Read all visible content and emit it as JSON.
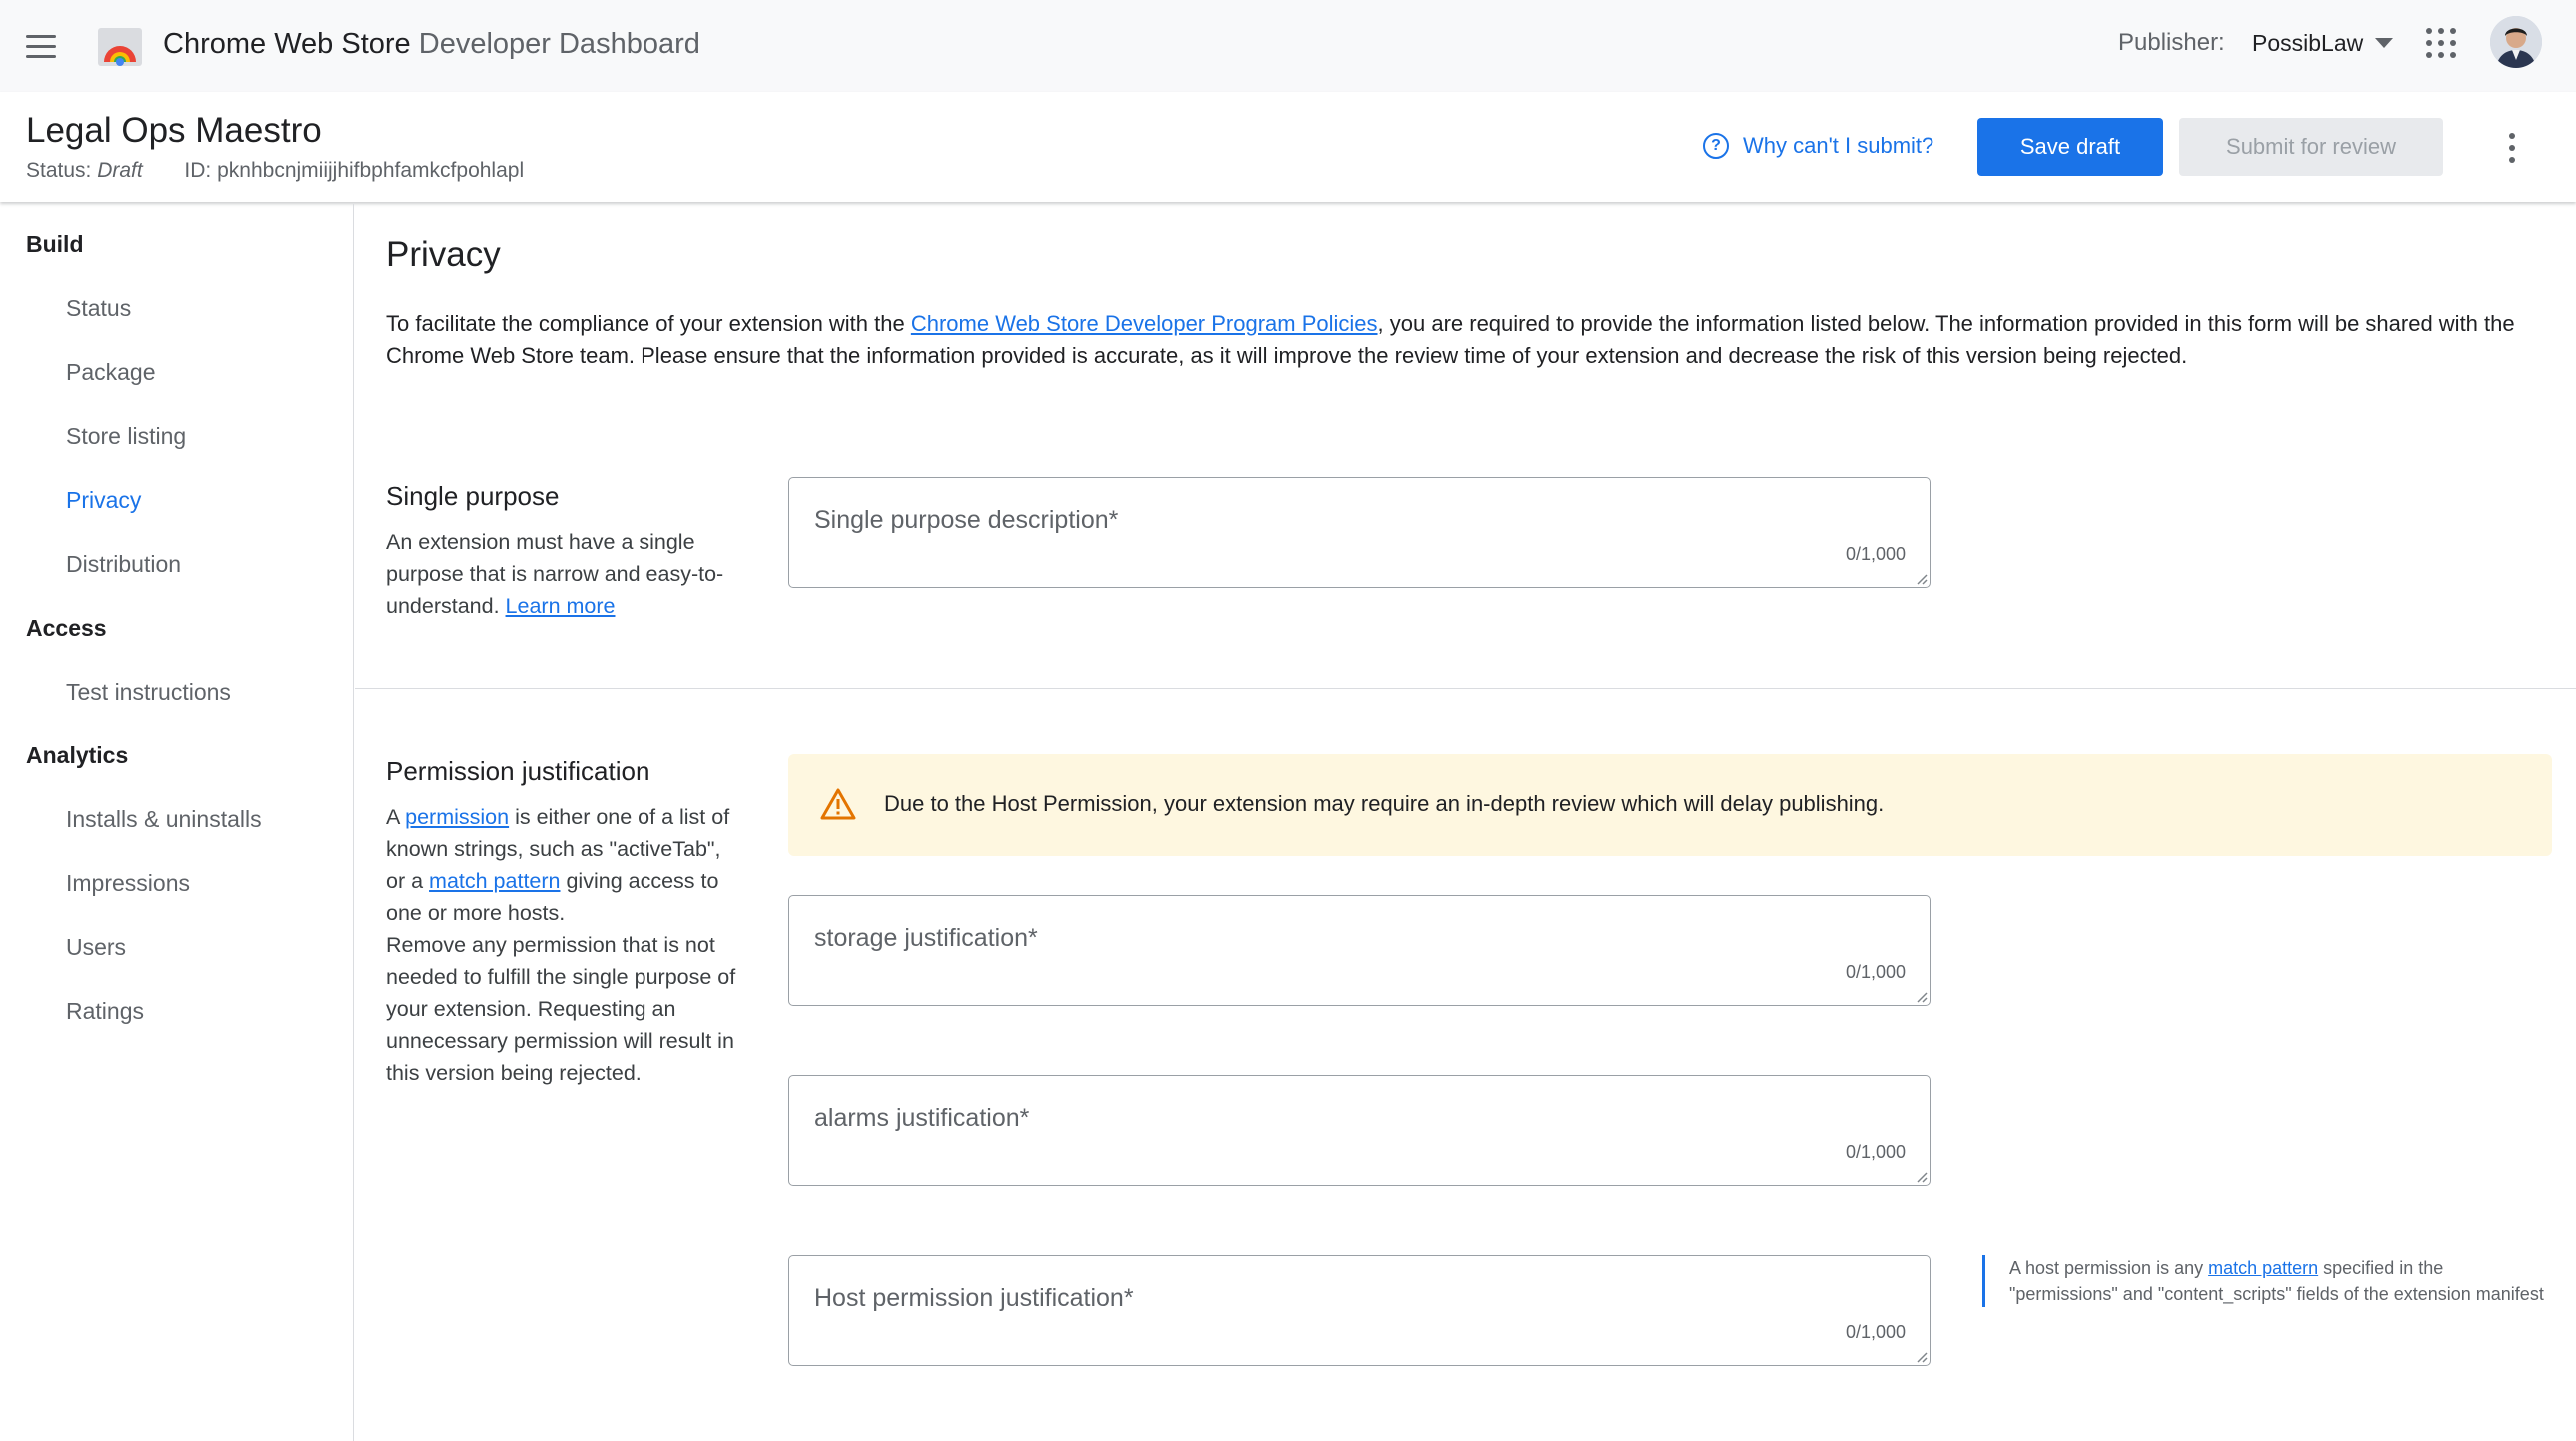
{
  "appbar": {
    "title_main": "Chrome Web Store",
    "title_sub": "Developer Dashboard",
    "publisher_label": "Publisher:",
    "publisher_value": "PossibLaw"
  },
  "item": {
    "name": "Legal Ops Maestro",
    "status_label": "Status:",
    "status_value": "Draft",
    "id_label": "ID:",
    "id_value": "pknhbcnjmiijjhifbphfamkcfpohlapl",
    "why_link": "Why can't I submit?",
    "save_label": "Save draft",
    "submit_label": "Submit for review"
  },
  "sidebar": {
    "build": "Build",
    "build_items": [
      "Status",
      "Package",
      "Store listing",
      "Privacy",
      "Distribution"
    ],
    "access": "Access",
    "access_items": [
      "Test instructions"
    ],
    "analytics": "Analytics",
    "analytics_items": [
      "Installs & uninstalls",
      "Impressions",
      "Users",
      "Ratings"
    ],
    "active": "Privacy"
  },
  "main": {
    "title": "Privacy",
    "intro_before": "To facilitate the compliance of your extension with the ",
    "intro_link": "Chrome Web Store Developer Program Policies",
    "intro_after": ", you are required to provide the information listed below. The information provided in this form will be shared with the Chrome Web Store team. Please ensure that the information provided is accurate, as it will improve the review time of your extension and decrease the risk of this version being rejected.",
    "single_purpose": {
      "title": "Single purpose",
      "desc": "An extension must have a single purpose that is narrow and easy-to-understand. ",
      "learn_more": "Learn more",
      "placeholder": "Single purpose description*",
      "count": "0/1,000"
    },
    "permission": {
      "title": "Permission justification",
      "desc_a": "A ",
      "link_permission": "permission",
      "desc_b": " is either one of a list of known strings, such as \"activeTab\", or a ",
      "link_match": "match pattern",
      "desc_c": " giving access to one or more hosts.",
      "desc_d": "Remove any permission that is not needed to fulfill the single purpose of your extension. Requesting an unnecessary permission will result in this version being rejected.",
      "warning": "Due to the Host Permission, your extension may require an in-depth review which will delay publishing.",
      "fields": [
        {
          "placeholder": "storage justification*",
          "count": "0/1,000"
        },
        {
          "placeholder": "alarms justification*",
          "count": "0/1,000"
        },
        {
          "placeholder": "Host permission justification*",
          "count": "0/1,000"
        }
      ],
      "host_note_a": "A host permission is any ",
      "host_note_link": "match pattern",
      "host_note_b": " specified in the \"permissions\" and \"content_scripts\" fields of the extension manifest"
    }
  },
  "colors": {
    "accent": "#1a73e8",
    "warning_bg": "#fef7e0",
    "warning_icon": "#e37400"
  }
}
